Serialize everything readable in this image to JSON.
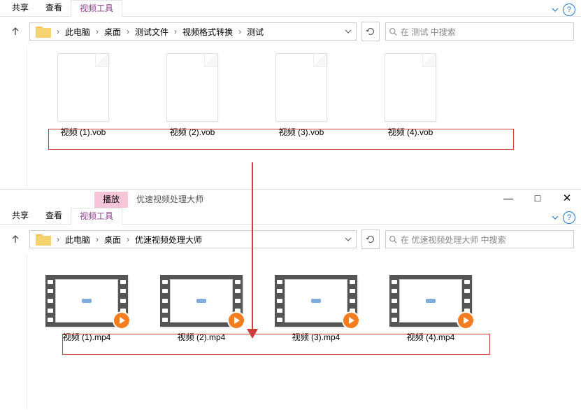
{
  "top": {
    "tabs": {
      "share": "共享",
      "view": "查看",
      "tools": "视频工具"
    },
    "breadcrumb": [
      "此电脑",
      "桌面",
      "测试文件",
      "视频格式转换",
      "测试"
    ],
    "search_placeholder": "在 测试 中搜索",
    "files": [
      {
        "name": "视频 (1).vob"
      },
      {
        "name": "视频 (2).vob"
      },
      {
        "name": "视频 (3).vob"
      },
      {
        "name": "视频 (4).vob"
      }
    ]
  },
  "bottom": {
    "context_tab": "播放",
    "app_title": "优速视频处理大师",
    "tabs": {
      "share": "共享",
      "view": "查看",
      "tools": "视频工具"
    },
    "breadcrumb": [
      "此电脑",
      "桌面",
      "优速视频处理大师"
    ],
    "search_placeholder": "在 优速视频处理大师 中搜索",
    "files": [
      {
        "name": "视频 (1).mp4"
      },
      {
        "name": "视频 (2).mp4"
      },
      {
        "name": "视频 (3).mp4"
      },
      {
        "name": "视频 (4).mp4"
      }
    ]
  },
  "icons": {
    "help": "?"
  }
}
